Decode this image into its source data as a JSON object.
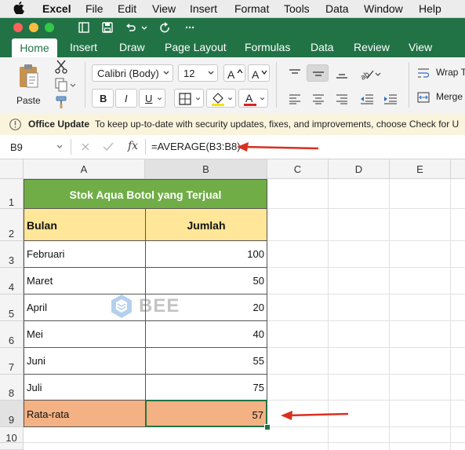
{
  "menubar": {
    "items": [
      "Excel",
      "File",
      "Edit",
      "View",
      "Insert",
      "Format",
      "Tools",
      "Data",
      "Window",
      "Help"
    ]
  },
  "ribbon": {
    "tabs": [
      "Home",
      "Insert",
      "Draw",
      "Page Layout",
      "Formulas",
      "Data",
      "Review",
      "View"
    ],
    "paste_label": "Paste",
    "font_name": "Calibri (Body)",
    "font_size": "12",
    "bold": "B",
    "italic": "I",
    "underline": "U",
    "wrap_text": "Wrap T",
    "merge": "Merge"
  },
  "infobar": {
    "title": "Office Update",
    "message": "To keep up-to-date with security updates, fixes, and improvements, choose Check for U"
  },
  "formulabar": {
    "name_box": "B9",
    "fx": "fx",
    "formula": "=AVERAGE(B3:B8)"
  },
  "sheet": {
    "columns": [
      "A",
      "B",
      "C",
      "D",
      "E"
    ],
    "rows": [
      "1",
      "2",
      "3",
      "4",
      "5",
      "6",
      "7",
      "8",
      "9",
      "10"
    ],
    "title": "Stok Aqua Botol yang Terjual",
    "header_month": "Bulan",
    "header_total": "Jumlah",
    "data": [
      {
        "month": "Februari",
        "total": "100"
      },
      {
        "month": "Maret",
        "total": "50"
      },
      {
        "month": "April",
        "total": "20"
      },
      {
        "month": "Mei",
        "total": "40"
      },
      {
        "month": "Juni",
        "total": "55"
      },
      {
        "month": "Juli",
        "total": "75"
      }
    ],
    "avg_label": "Rata-rata",
    "avg_value": "57"
  },
  "watermark": "BEE",
  "colors": {
    "excel_green": "#217346",
    "title_fill": "#70ad47",
    "header_fill": "#ffe699",
    "avg_fill": "#f4b183",
    "arrow": "#d9301f"
  }
}
